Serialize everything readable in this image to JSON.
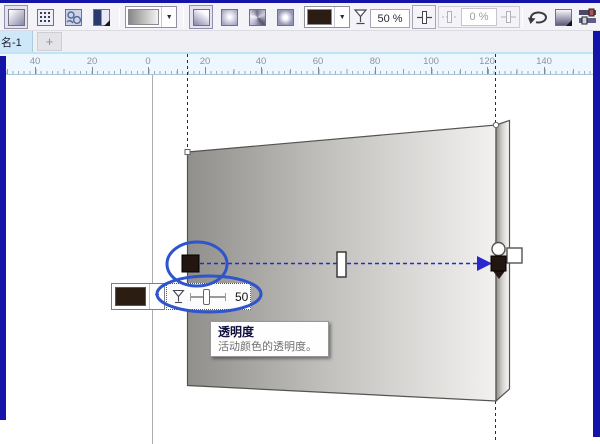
{
  "toolbar": {
    "transparency_percent": "50 %",
    "fade_percent": "0 %"
  },
  "tabbar": {
    "active_tab_label": "名-1",
    "new_tab_label": "+"
  },
  "ruler": {
    "ticks": [
      "40",
      "20",
      "0",
      "20",
      "40",
      "60",
      "80",
      "100",
      "120",
      "140"
    ]
  },
  "transparency_flyout": {
    "value": "50"
  },
  "tooltip": {
    "title": "透明度",
    "description": "活动颜色的透明度。"
  },
  "icons": {
    "dropdown_glyph": "▼"
  },
  "colors": {
    "window_border": "#1414a8",
    "annotation_blue": "#2f55cc",
    "arrow_blue": "#2828cc",
    "active_color_swatch": "#2c1d13",
    "tab_active_bg": "#cfe8f9"
  }
}
